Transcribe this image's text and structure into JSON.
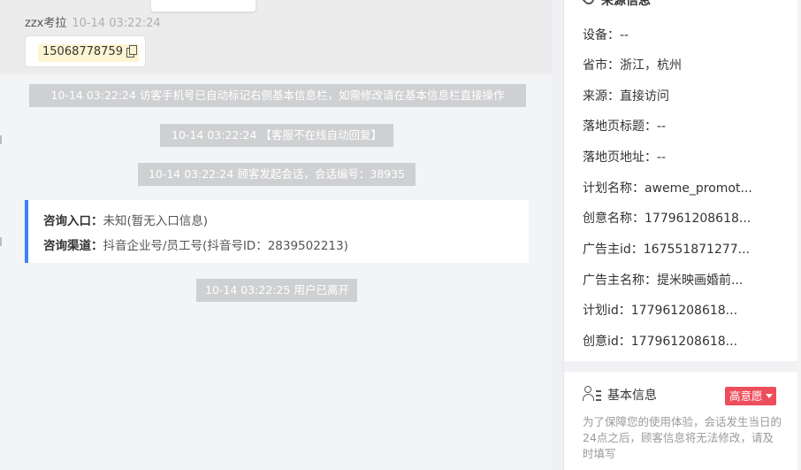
{
  "chat": {
    "sender_name": "zzx考拉",
    "sender_time": "10-14 03:22:24",
    "phone_number": "15068778759",
    "copy_icon": "copy-icon",
    "system_messages": [
      "10-14 03:22:24 访客手机号已自动标记右侧基本信息栏，如需修改请在基本信息栏直接操作",
      "10-14 03:22:24 【客服不在线自动回复】",
      "10-14 03:22:24 顾客发起会话，会话编号：38935"
    ],
    "consult": {
      "entry_key": "咨询入口：",
      "entry_value": "未知(暂无入口信息)",
      "channel_key": "咨询渠道：",
      "channel_value": "抖音企业号/员工号(抖音号ID：2839502213)"
    },
    "leave_message": "10-14 03:22:25 用户已离开"
  },
  "panel": {
    "source_title": "来源信息",
    "source_icon": "location-pin-icon",
    "rows": [
      "设备：--",
      "省市：浙江，杭州",
      "来源：直接访问",
      "落地页标题：--",
      "落地页地址：--",
      "计划名称：aweme_promot...",
      "创意名称：177961208618...",
      "广告主id：167551871277...",
      "广告主名称：提米映画婚前...",
      "计划id：177961208618...",
      "创意id：177961208618..."
    ],
    "basic_title": "基本信息",
    "basic_icon": "user-list-icon",
    "intent_badge": "高意愿",
    "notice": "为了保障您的使用体验，会话发生当日的24点之后，顾客信息将无法修改，请及时填写"
  },
  "colors": {
    "accent_blue": "#3c82f7",
    "badge_red": "#ee4d5b",
    "phone_highlight": "#fff4d2",
    "system_msg_bg": "#cfd0d2"
  }
}
